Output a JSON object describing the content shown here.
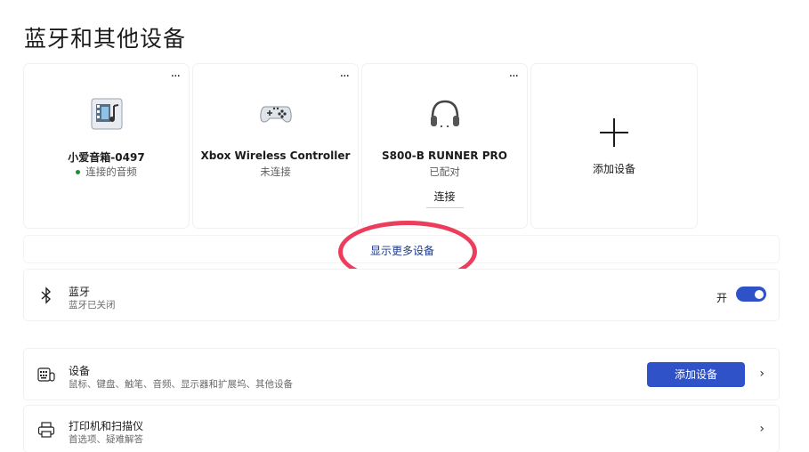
{
  "page_title": "蓝牙和其他设备",
  "cards": [
    {
      "name": "小爱音箱-0497",
      "status": "连接的音频",
      "icon": "media-icon",
      "more": "···"
    },
    {
      "name": "Xbox Wireless Controller",
      "status": "未连接",
      "icon": "gamepad-icon",
      "more": "···"
    },
    {
      "name": "S800-B RUNNER PRO",
      "status": "已配对",
      "icon": "headphones-icon",
      "more": "···",
      "action": "连接"
    }
  ],
  "add_card": {
    "label": "添加设备",
    "icon": "plus-icon"
  },
  "show_more": "显示更多设备",
  "bluetooth": {
    "title": "蓝牙",
    "subtitle": "蓝牙已关闭",
    "toggle_label": "开",
    "icon": "bluetooth-icon",
    "toggle_on": true
  },
  "devices": {
    "title": "设备",
    "subtitle": "鼠标、键盘、触笔、音频、显示器和扩展坞、其他设备",
    "button": "添加设备",
    "icon": "keyboard-icon"
  },
  "printers": {
    "title": "打印机和扫描仪",
    "subtitle": "首选项、疑难解答",
    "icon": "printer-icon"
  },
  "colors": {
    "accent": "#2f52c9",
    "highlight": "#ec3e5c",
    "connected_dot": "#1a8f2e"
  }
}
